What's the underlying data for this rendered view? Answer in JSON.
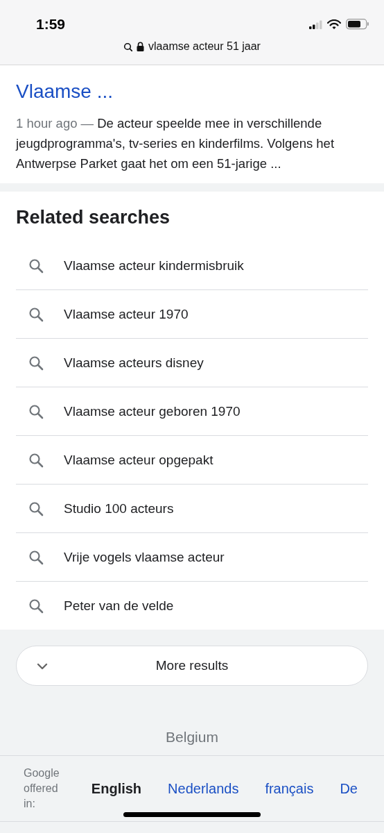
{
  "status_bar": {
    "time": "1:59"
  },
  "address_bar": {
    "url": "vlaamse acteur 51 jaar"
  },
  "result": {
    "title": "Vlaamse ...",
    "age": "1 hour ago —",
    "snippet": "De acteur speelde mee in verschillende jeugdprogramma's, tv-series en kinderfilms. Volgens het Antwerpse Parket gaat het om een 51-jarige ..."
  },
  "related_searches": {
    "heading": "Related searches",
    "items": [
      "Vlaamse acteur kindermisbruik",
      "Vlaamse acteur 1970",
      "Vlaamse acteurs disney",
      "Vlaamse acteur geboren 1970",
      "Vlaamse acteur opgepakt",
      "Studio 100 acteurs",
      "Vrije vogels vlaamse acteur",
      "Peter van de velde"
    ]
  },
  "more_button": {
    "label": "More results"
  },
  "location": "Belgium",
  "languages": {
    "label": "Google offered in:",
    "items": [
      {
        "name": "English",
        "selected": true
      },
      {
        "name": "Nederlands",
        "selected": false
      },
      {
        "name": "français",
        "selected": false
      },
      {
        "name": "De",
        "selected": false
      }
    ]
  }
}
